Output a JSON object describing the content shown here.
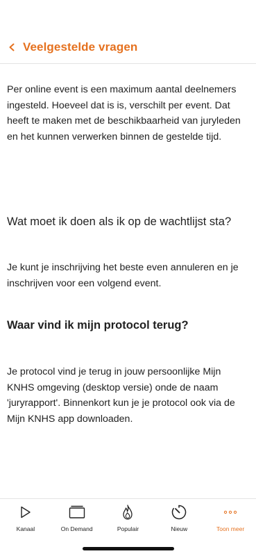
{
  "header": {
    "title": "Veelgestelde vragen"
  },
  "content": {
    "intro": "Per online event is een maximum aantal deelnemers ingesteld. Hoeveel dat is is, verschilt per event. Dat heeft te maken met de beschikbaarheid van juryleden en het kunnen verwerken binnen de gestelde tijd.",
    "faq": [
      {
        "question": "Wat moet ik doen als ik op de wachtlijst sta?",
        "answer": "Je kunt je inschrijving het beste even annuleren en je inschrijven voor een volgend event."
      },
      {
        "question": "Waar vind ik mijn protocol terug?",
        "answer": "Je protocol vind je terug in jouw persoonlijke Mijn KNHS omgeving (desktop versie) onde de naam 'juryrapport'. Binnenkort kun je je protocol ook via de Mijn KNHS app downloaden."
      }
    ]
  },
  "tabbar": {
    "tabs": [
      {
        "label": "Kanaal",
        "icon": "play-icon"
      },
      {
        "label": "On Demand",
        "icon": "tv-icon"
      },
      {
        "label": "Populair",
        "icon": "flame-icon"
      },
      {
        "label": "Nieuw",
        "icon": "timer-icon"
      },
      {
        "label": "Toon meer",
        "icon": "more-icon",
        "active": true
      }
    ]
  },
  "colors": {
    "accent": "#e5711f",
    "text": "#222222",
    "divider": "#e3e3e3"
  }
}
